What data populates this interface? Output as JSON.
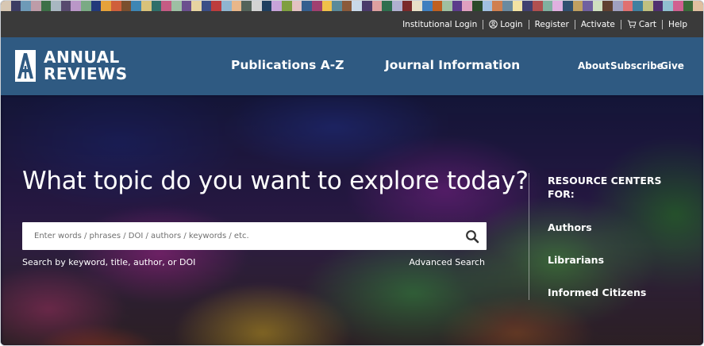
{
  "strip_colors": [
    "#d7c7b3",
    "#3c3c63",
    "#6e9ab7",
    "#bd9ca8",
    "#3d6f47",
    "#a8b7c1",
    "#574a6e",
    "#ba97c8",
    "#7aaa84",
    "#223a7a",
    "#e6a23a",
    "#cf5f3b",
    "#7a4f2e",
    "#3e86b4",
    "#d9c27a",
    "#2f6f6a",
    "#c45b84",
    "#9dbfa3",
    "#6a4f8e",
    "#e7d4a1",
    "#3a4e86",
    "#bd3d3d",
    "#8fb5d0",
    "#e9b78a",
    "#54635a",
    "#d3d3d3",
    "#1f3f5f",
    "#c7a3d9",
    "#7f9f3f",
    "#e3c2c2",
    "#355e8e",
    "#a04070",
    "#f0c04a",
    "#5a8a9a",
    "#8a5a3a",
    "#c9d9e9",
    "#4a3a6a",
    "#dda0a0",
    "#2e6e4e",
    "#b0b0d0",
    "#7a2a2a",
    "#e8e0c8",
    "#3f7fbf",
    "#c06020",
    "#9fc0a0",
    "#5b3b8b",
    "#e0a0c0",
    "#2a4a2a",
    "#a0c0e0",
    "#d08050",
    "#6a8aa0",
    "#f3e3a3",
    "#404070",
    "#b05050",
    "#80b0a0",
    "#e0b0e0",
    "#305070",
    "#c0a060",
    "#7060a0",
    "#d0e0c0",
    "#604030",
    "#a0a0c0",
    "#e07070",
    "#4080a0",
    "#c0c080",
    "#503070",
    "#90c0d0",
    "#d06090",
    "#3a6a3a",
    "#e0c0a0"
  ],
  "utility": {
    "institutional_login": "Institutional Login",
    "login": "Login",
    "register": "Register",
    "activate": "Activate",
    "cart": "Cart",
    "help": "Help"
  },
  "nav": {
    "logo_line1": "ANNUAL",
    "logo_line2": "REVIEWS",
    "publications": "Publications A-Z",
    "journal_info": "Journal Information",
    "about": "About",
    "subscribe": "Subscribe",
    "give": "Give"
  },
  "hero": {
    "headline": "What topic do you want to explore today?",
    "search_placeholder": "Enter words / phrases / DOI / authors / keywords / etc.",
    "search_value": "",
    "hint": "Search by keyword, title, author, or DOI",
    "advanced_search": "Advanced Search"
  },
  "resource_centers": {
    "title": "RESOURCE CENTERS FOR:",
    "links": [
      "Authors",
      "Librarians",
      "Informed Citizens"
    ]
  },
  "colors": {
    "utility_bg": "#3a3a3a",
    "nav_bg": "#2f5a82",
    "text": "#ffffff"
  },
  "icons": {
    "login": "user-circle-icon",
    "cart": "cart-icon",
    "search": "search-icon"
  }
}
